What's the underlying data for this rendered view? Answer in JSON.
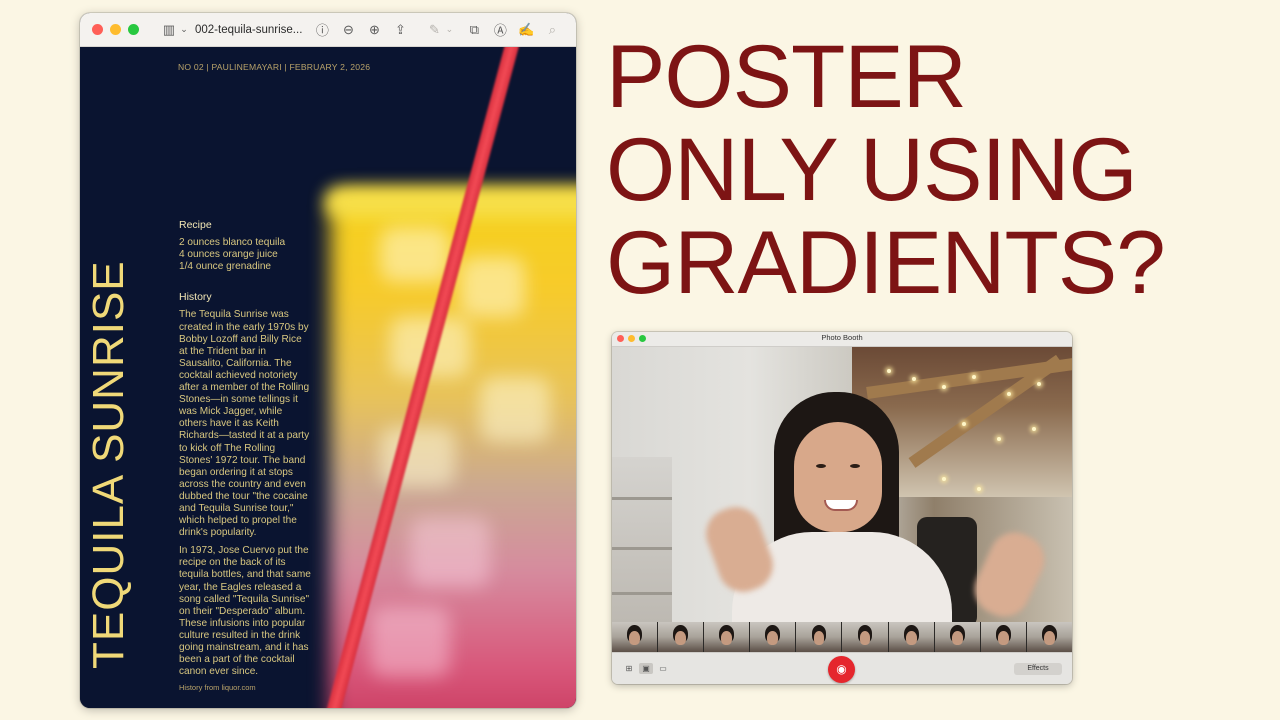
{
  "preview": {
    "title": "002-tequila-sunrise...",
    "toolbar_icons": [
      "sidebar-icon",
      "chevron-down-icon",
      "info-icon",
      "zoom-out-icon",
      "zoom-in-icon",
      "share-icon",
      "markup-icon",
      "chevron-down-icon",
      "rotate-icon",
      "annotate-icon",
      "signature-icon",
      "search-icon"
    ]
  },
  "poster": {
    "vertical_title": "TEQUILA SUNRISE",
    "meta": "NO 02 | PAULINEMAYARI | FEBRUARY 2, 2026",
    "recipe_heading": "Recipe",
    "recipe_lines": [
      "2 ounces blanco tequila",
      "4 ounces orange juice",
      "1/4 ounce grenadine"
    ],
    "history_heading": "History",
    "history_p1": "The Tequila Sunrise was created in the early 1970s by Bobby Lozoff and Billy Rice at the Trident bar in Sausalito, California. The cocktail achieved notoriety after a member of the Rolling Stones—in some tellings it was Mick Jagger, while others have it as Keith Richards—tasted it at a party to kick off The Rolling Stones' 1972 tour. The band began ordering it at stops across the country and even dubbed the tour \"the cocaine and Tequila Sunrise tour,\" which helped to propel the drink's popularity.",
    "history_p2": "In 1973, Jose Cuervo put the recipe on the back of its tequila bottles, and that same year, the Eagles released a song called \"Tequila Sunrise\" on their \"Desperado\" album. These infusions into popular culture resulted in the drink going mainstream, and it has been a part of the cocktail canon ever since.",
    "credit": "History from liquor.com"
  },
  "headline": {
    "line1": "POSTER",
    "line2": "ONLY USING",
    "line3": "GRADIENTS?",
    "color": "#7d1414"
  },
  "photobooth": {
    "title": "Photo Booth",
    "effects_label": "Effects",
    "shutter_icon": "camera-icon",
    "view_icons": [
      "grid-icon",
      "photo-icon",
      "video-icon"
    ]
  }
}
